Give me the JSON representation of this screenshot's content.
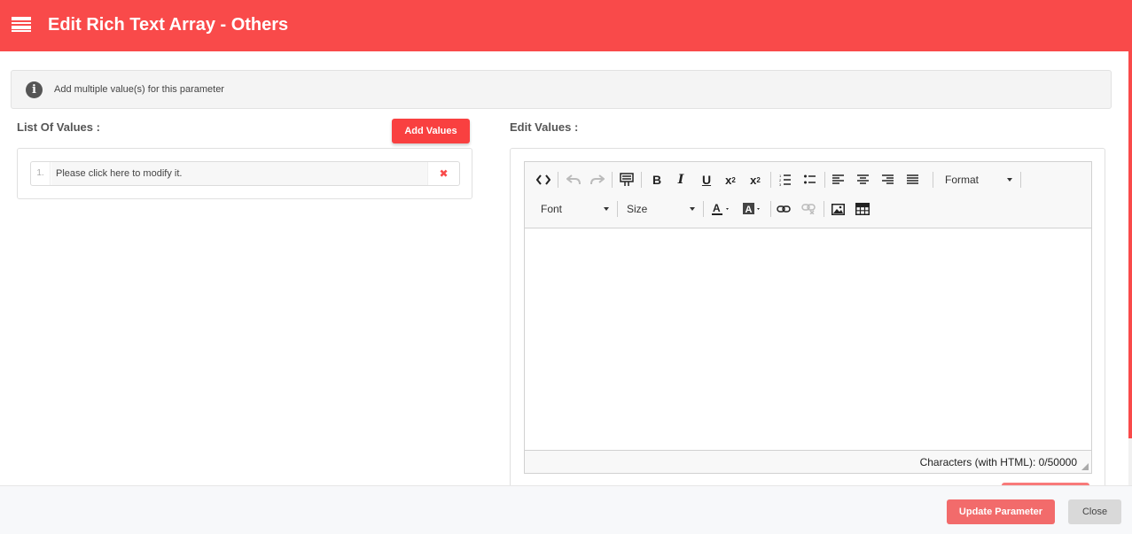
{
  "header": {
    "title": "Edit Rich Text Array - Others",
    "icon": "menu-icon"
  },
  "info": {
    "text": "Add multiple value(s) for this parameter",
    "icon": "info-icon"
  },
  "list": {
    "label": "List Of Values :",
    "add_label": "Add Values",
    "items": [
      {
        "num": "1.",
        "text": "Please click here to modify it.",
        "remove": "✖"
      }
    ]
  },
  "editor": {
    "label": "Edit Values :",
    "format_label": "Format",
    "font_label": "Font",
    "size_label": "Size",
    "char_count": "Characters (with HTML): 0/50000"
  },
  "footer": {
    "update_label": "Update Parameter",
    "close_label": "Close"
  },
  "colors": {
    "accent": "#f94a4a",
    "update": "#f26b6b",
    "close": "#d9d9d9"
  }
}
